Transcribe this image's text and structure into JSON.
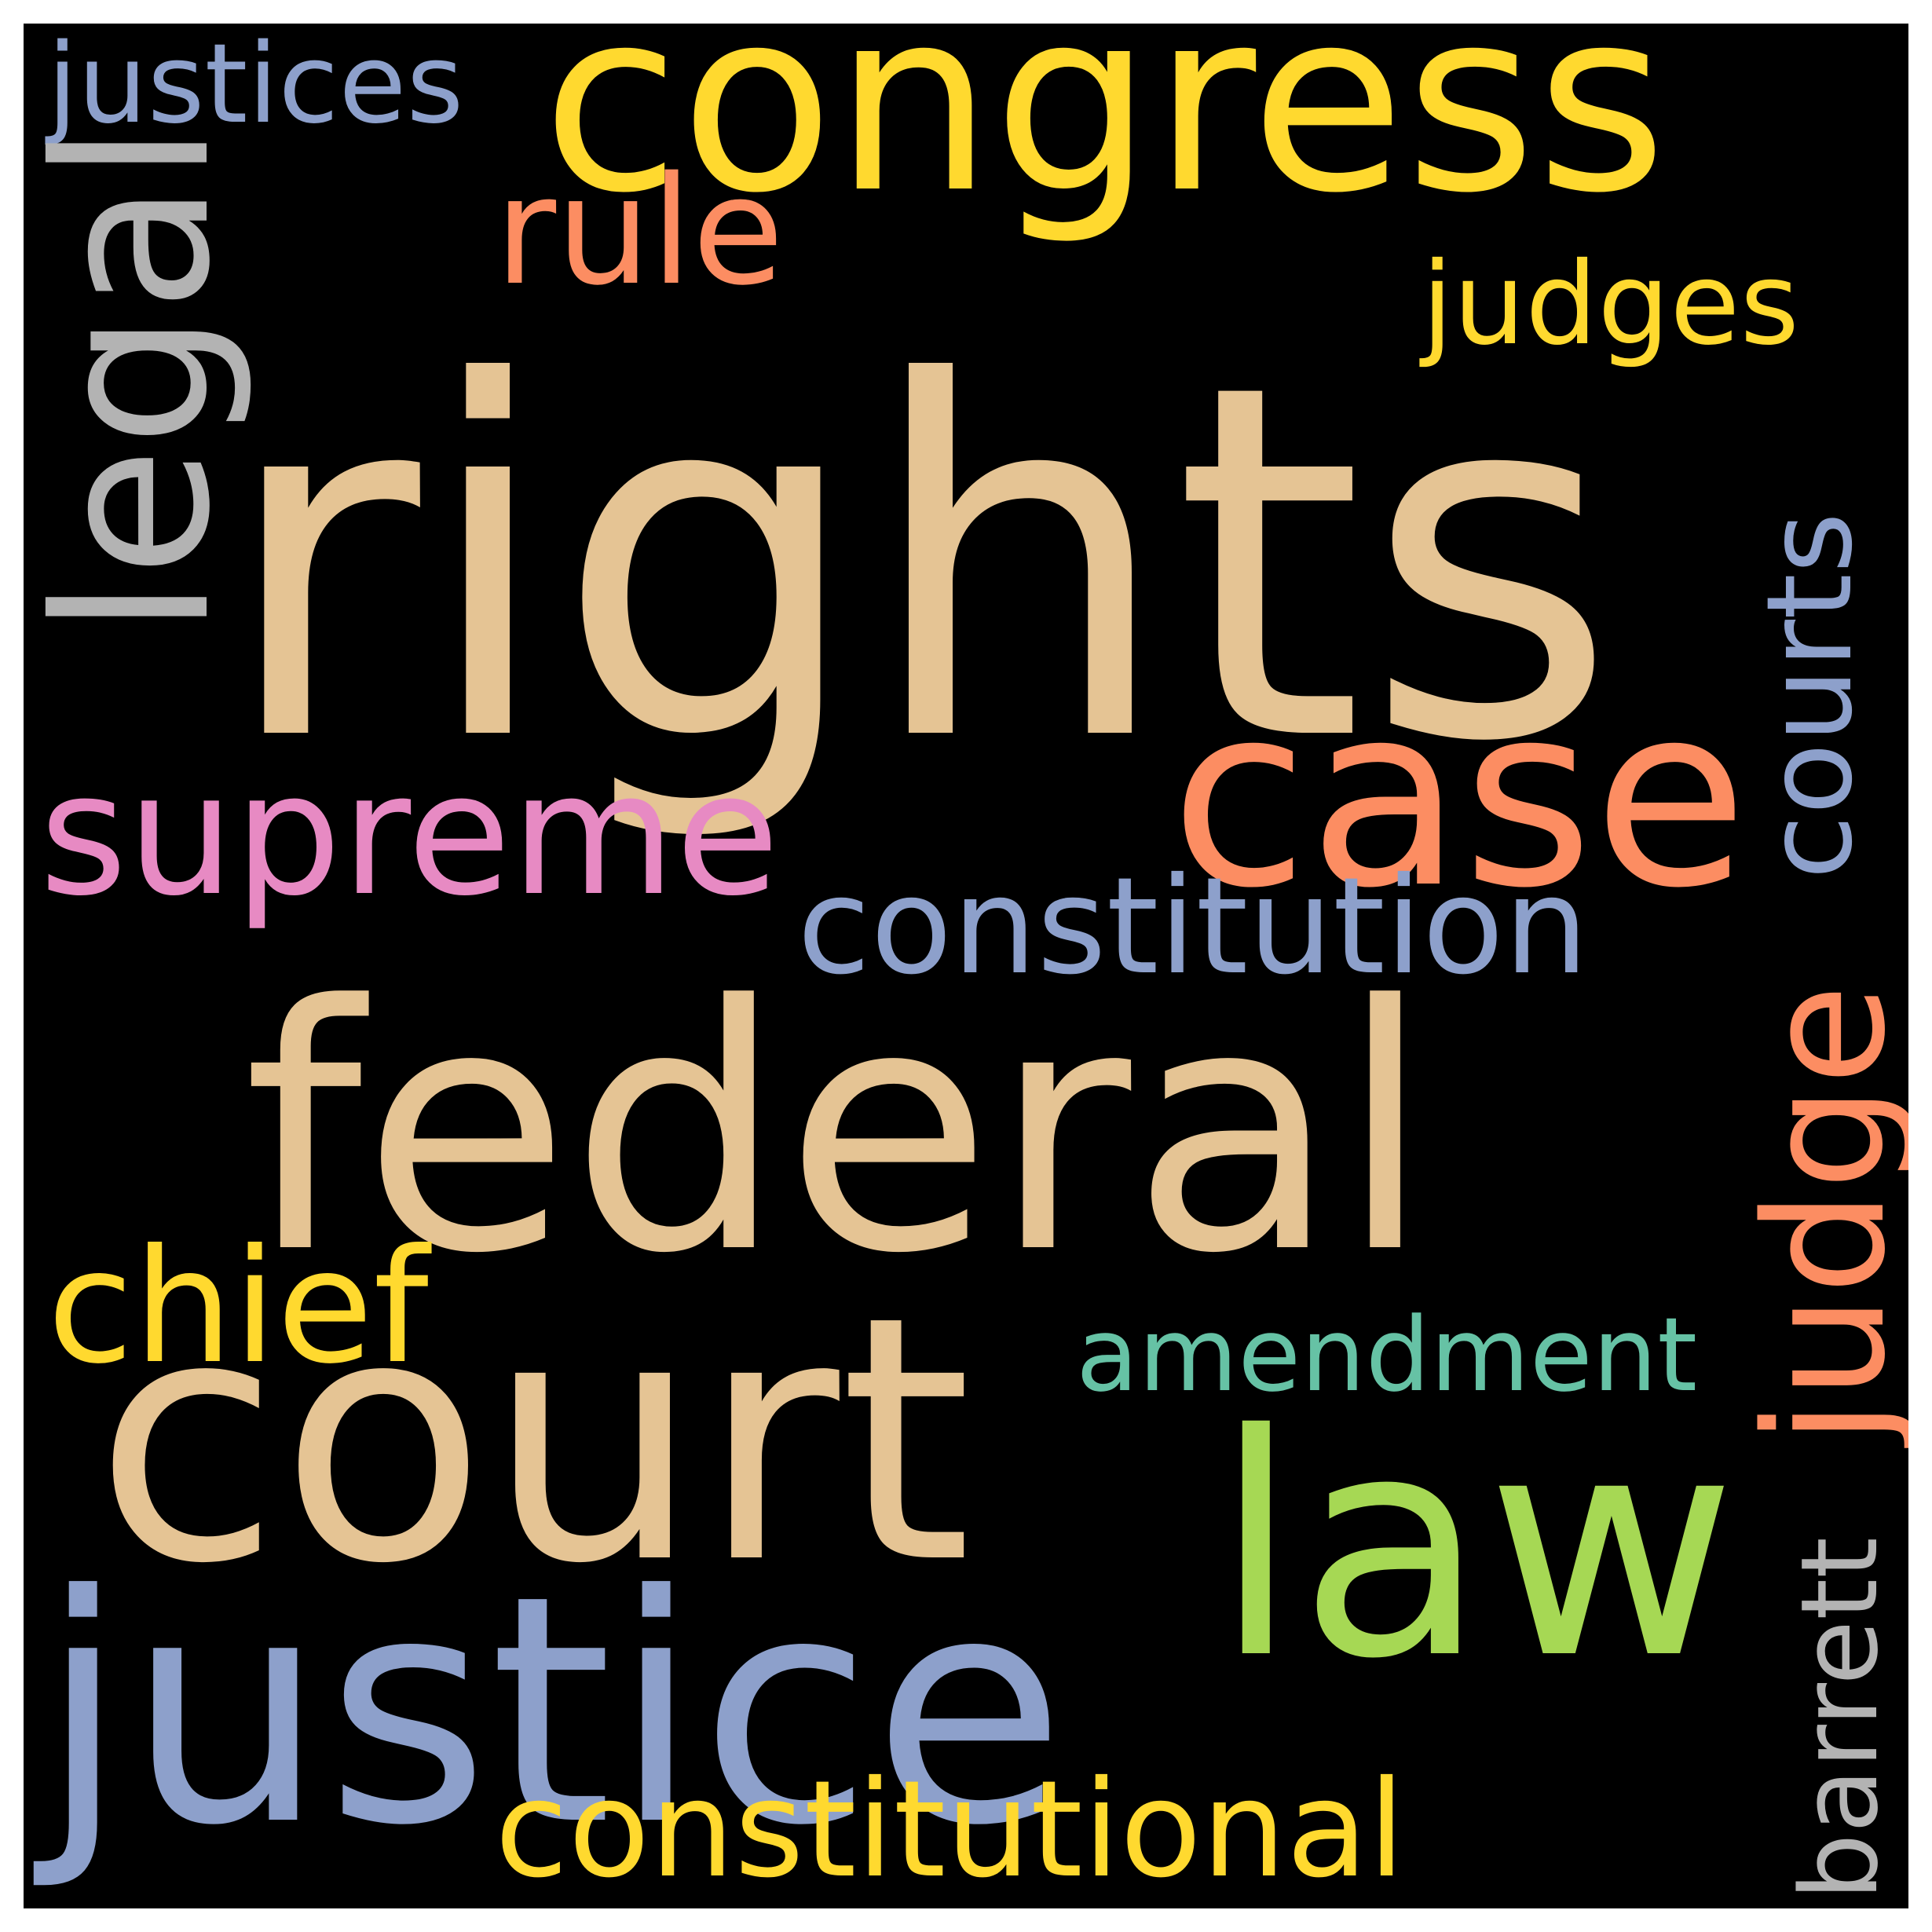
{
  "words": [
    {
      "id": "rights",
      "text": "rights",
      "color": "#e5c494"
    },
    {
      "id": "congress",
      "text": "congress",
      "color": "#ffd92f"
    },
    {
      "id": "justices",
      "text": "justices",
      "color": "#8da0cb"
    },
    {
      "id": "rule",
      "text": "rule",
      "color": "#fc8d62"
    },
    {
      "id": "judges",
      "text": "judges",
      "color": "#ffd92f"
    },
    {
      "id": "legal",
      "text": "legal",
      "color": "#b3b3b3"
    },
    {
      "id": "courts",
      "text": "courts",
      "color": "#8da0cb"
    },
    {
      "id": "case",
      "text": "case",
      "color": "#fc8d62"
    },
    {
      "id": "supreme",
      "text": "supreme",
      "color": "#e78ac3"
    },
    {
      "id": "constitution",
      "text": "constitution",
      "color": "#8da0cb"
    },
    {
      "id": "federal",
      "text": "federal",
      "color": "#e5c494"
    },
    {
      "id": "judge",
      "text": "judge",
      "color": "#fc8d62"
    },
    {
      "id": "chief",
      "text": "chief",
      "color": "#ffd92f"
    },
    {
      "id": "amendment",
      "text": "amendment",
      "color": "#66c2a5"
    },
    {
      "id": "court",
      "text": "court",
      "color": "#e5c494"
    },
    {
      "id": "law",
      "text": "law",
      "color": "#a6d854"
    },
    {
      "id": "barrett",
      "text": "barrett",
      "color": "#b3b3b3"
    },
    {
      "id": "justice",
      "text": "justice",
      "color": "#8da0cb"
    },
    {
      "id": "constitutional",
      "text": "constitutional",
      "color": "#ffd92f"
    }
  ]
}
